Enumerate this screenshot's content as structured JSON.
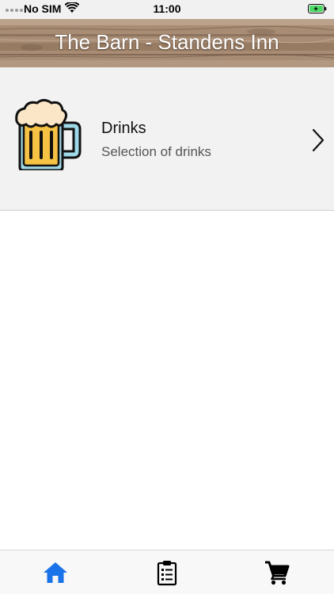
{
  "status_bar": {
    "carrier": "No SIM",
    "time": "11:00"
  },
  "header": {
    "title": "The Barn - Standens Inn"
  },
  "list": {
    "items": [
      {
        "title": "Drinks",
        "subtitle": "Selection of drinks",
        "icon": "beer-mug-icon"
      }
    ]
  },
  "tab_bar": {
    "tabs": [
      {
        "icon": "home-icon",
        "selected": true
      },
      {
        "icon": "clipboard-list-icon",
        "selected": false
      },
      {
        "icon": "shopping-cart-icon",
        "selected": false
      }
    ],
    "active_color": "#1a73e8",
    "inactive_color": "#000000"
  },
  "colors": {
    "battery_fill": "#4cd964",
    "header_wood": "#9e8169",
    "list_background": "#f2f2f2"
  }
}
